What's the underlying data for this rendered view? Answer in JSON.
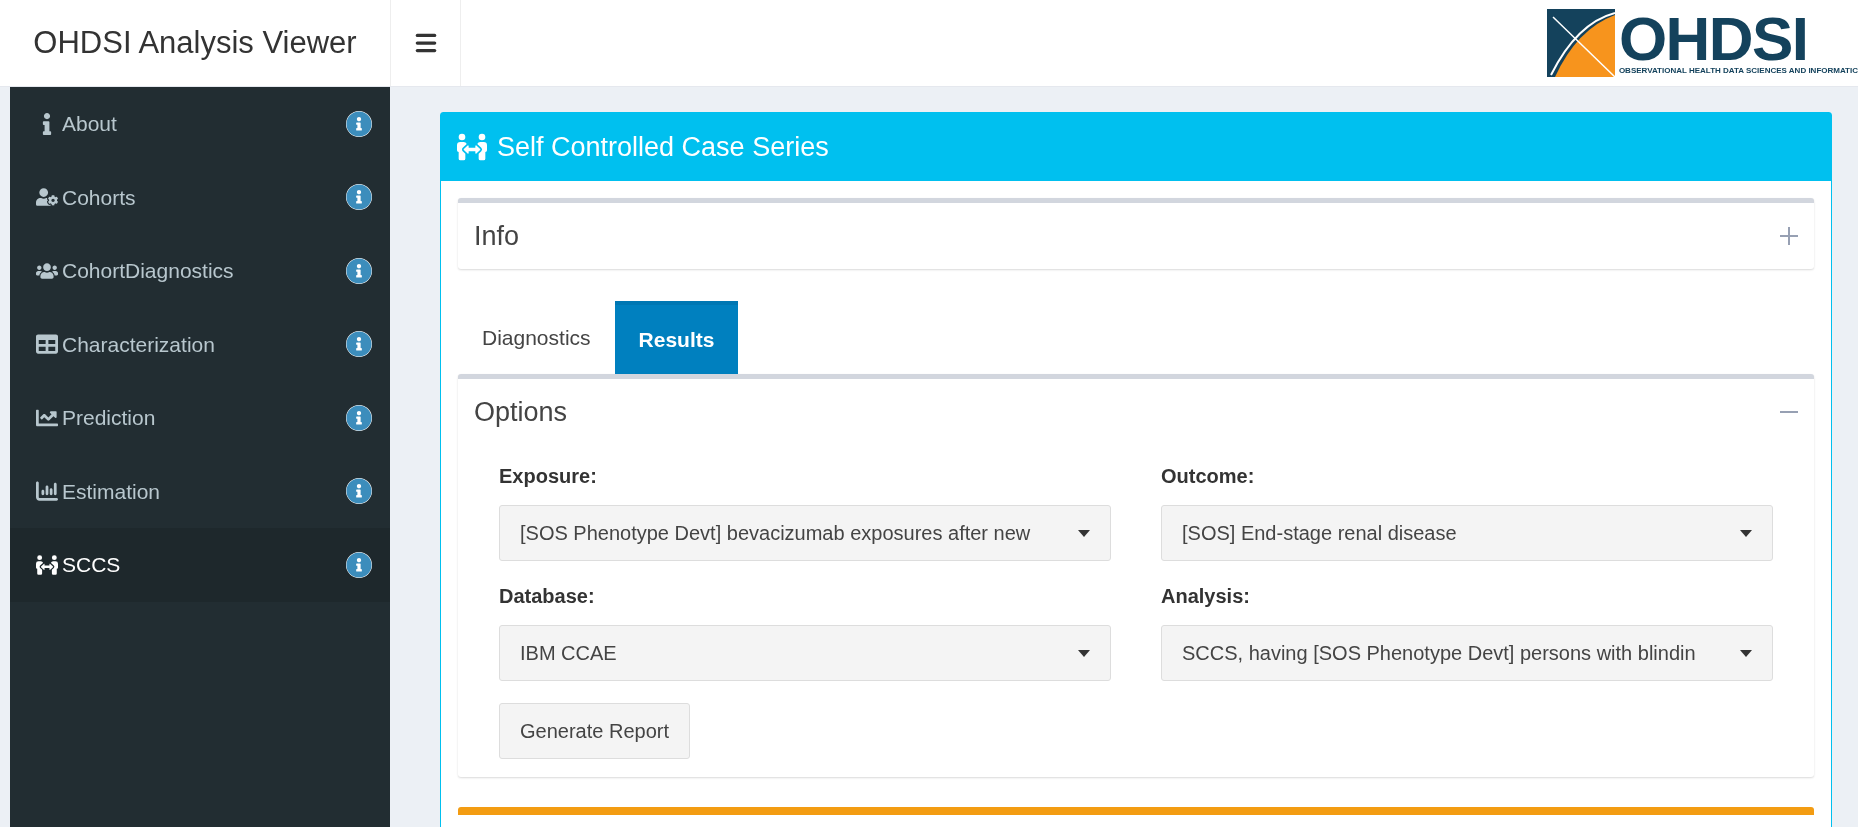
{
  "app_title": "OHDSI Analysis Viewer",
  "logo": {
    "name": "OHDSI",
    "tagline": "OBSERVATIONAL HEALTH DATA SCIENCES AND INFORMATIC"
  },
  "sidebar": {
    "items": [
      {
        "label": "About",
        "selected": false
      },
      {
        "label": "Cohorts",
        "selected": false
      },
      {
        "label": "CohortDiagnostics",
        "selected": false
      },
      {
        "label": "Characterization",
        "selected": false
      },
      {
        "label": "Prediction",
        "selected": false
      },
      {
        "label": "Estimation",
        "selected": false
      },
      {
        "label": "SCCS",
        "selected": true
      }
    ]
  },
  "panel": {
    "title": "Self Controlled Case Series",
    "info_box": {
      "title": "Info",
      "expanded": false
    },
    "tabs": [
      {
        "label": "Diagnostics",
        "selected": false
      },
      {
        "label": "Results",
        "selected": true
      }
    ],
    "options_box": {
      "title": "Options",
      "expanded": true,
      "fields": [
        {
          "label": "Exposure:",
          "value": "[SOS Phenotype Devt] bevacizumab exposures after new"
        },
        {
          "label": "Outcome:",
          "value": "[SOS] End-stage renal disease"
        },
        {
          "label": "Database:",
          "value": "IBM CCAE"
        },
        {
          "label": "Analysis:",
          "value": "SCCS, having [SOS Phenotype Devt] persons with blindin"
        }
      ],
      "button": "Generate Report"
    }
  }
}
